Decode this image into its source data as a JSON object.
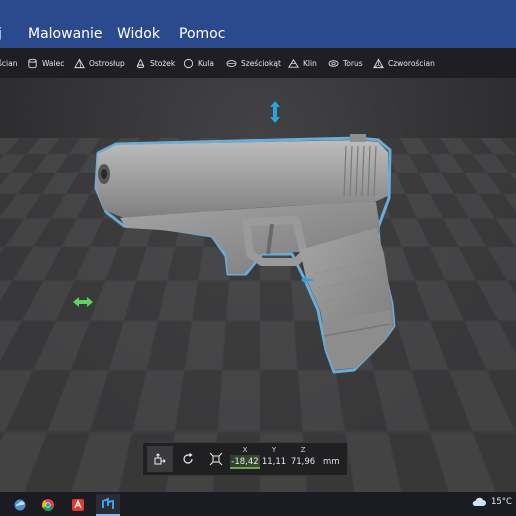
{
  "menu": {
    "items": [
      {
        "label": "j"
      },
      {
        "label": "Malowanie"
      },
      {
        "label": "Widok"
      },
      {
        "label": "Pomoc"
      }
    ]
  },
  "shapes": {
    "items": [
      {
        "label": "ścian",
        "icon": "cube-icon"
      },
      {
        "label": "Walec",
        "icon": "cylinder-icon"
      },
      {
        "label": "Ostrosłup",
        "icon": "pyramid-icon"
      },
      {
        "label": "Stożek",
        "icon": "cone-icon"
      },
      {
        "label": "Kula",
        "icon": "sphere-icon"
      },
      {
        "label": "Sześciokąt",
        "icon": "hexagon-icon"
      },
      {
        "label": "Klin",
        "icon": "wedge-icon"
      },
      {
        "label": "Torus",
        "icon": "torus-icon"
      },
      {
        "label": "Czworościan",
        "icon": "tetrahedron-icon"
      }
    ]
  },
  "transform": {
    "x_label": "X",
    "y_label": "Y",
    "z_label": "Z",
    "x_value": "-18,42",
    "y_value": "11,11",
    "z_value": "71,96",
    "unit": "mm"
  },
  "taskbar": {
    "temperature": "15°C"
  },
  "colors": {
    "menubar": "#2b4a8e",
    "selection_outline": "#6fb8e8",
    "x_axis_accent": "#6aa84f",
    "gizmo_blue": "#29a3e0",
    "gizmo_green": "#5fd35f"
  }
}
